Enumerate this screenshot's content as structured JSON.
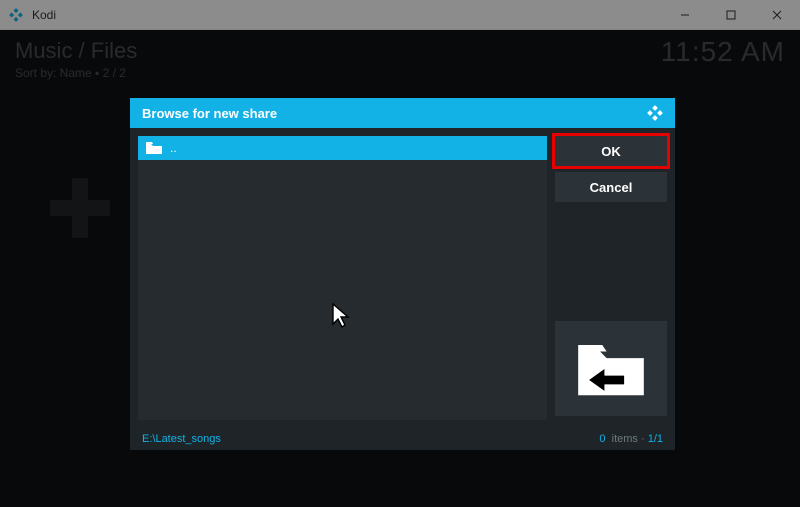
{
  "window": {
    "title": "Kodi",
    "controls": {
      "min": "minimize",
      "max": "maximize",
      "close": "close"
    }
  },
  "background": {
    "breadcrumb": "Music / Files",
    "sort_line": "Sort by: Name ▪ 2 / 2",
    "clock": "11:52 AM"
  },
  "dialog": {
    "title": "Browse for new share",
    "selected_row": {
      "label": ".."
    },
    "buttons": {
      "ok": "OK",
      "cancel": "Cancel"
    },
    "footer": {
      "path": "E:\\Latest_songs",
      "items_label": "items",
      "count": "0",
      "page": "1/1"
    }
  }
}
